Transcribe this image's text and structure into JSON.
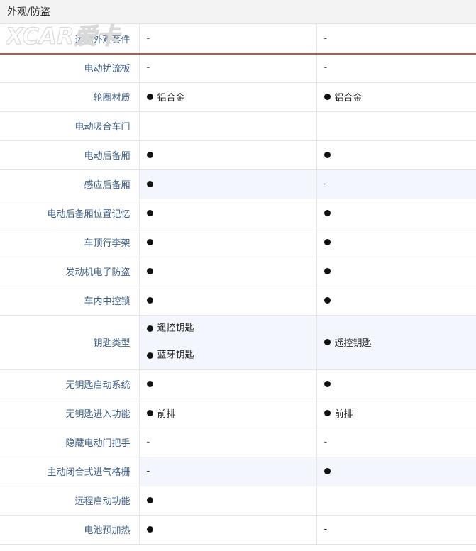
{
  "section": {
    "title": "外观/防盗"
  },
  "watermark": {
    "text": "XCAR爱卡"
  },
  "rows": [
    {
      "label": "运动外观套件",
      "v1": "-",
      "v2": "-"
    },
    {
      "label": "电动扰流板",
      "v1": "-",
      "v2": "-"
    },
    {
      "label": "轮圈材质",
      "v1": "● 铝合金",
      "v2": "● 铝合金"
    },
    {
      "label": "电动吸合车门",
      "v1": "",
      "v2": ""
    },
    {
      "label": "电动后备厢",
      "v1": "●",
      "v2": "●"
    },
    {
      "label": "感应后备厢",
      "v1": "●",
      "v2": "-"
    },
    {
      "label": "电动后备厢位置记忆",
      "v1": "●",
      "v2": "●"
    },
    {
      "label": "车顶行李架",
      "v1": "●",
      "v2": "●"
    },
    {
      "label": "发动机电子防盗",
      "v1": "●",
      "v2": "●"
    },
    {
      "label": "车内中控锁",
      "v1": "●",
      "v2": "●"
    },
    {
      "label": "钥匙类型",
      "v1a": "● 遥控钥匙",
      "v1b": "● 蓝牙钥匙",
      "v2": "● 遥控钥匙"
    },
    {
      "label": "无钥匙启动系统",
      "v1": "●",
      "v2": "●"
    },
    {
      "label": "无钥匙进入功能",
      "v1": "● 前排",
      "v2": "● 前排"
    },
    {
      "label": "隐藏电动门把手",
      "v1": "-",
      "v2": "-"
    },
    {
      "label": "主动闭合式进气格栅",
      "v1": "-",
      "v2": "●"
    },
    {
      "label": "远程启动功能",
      "v1": "●",
      "v2": ""
    },
    {
      "label": "电池预加热",
      "v1": "●",
      "v2": "-"
    }
  ]
}
